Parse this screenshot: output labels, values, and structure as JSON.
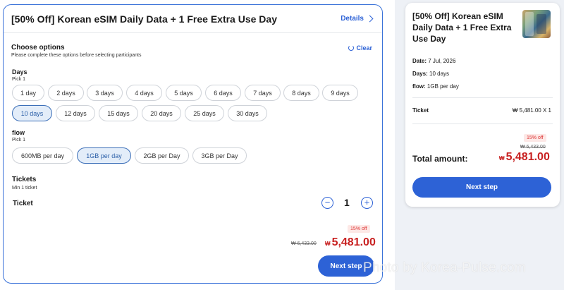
{
  "product": {
    "title": "[50% Off] Korean eSIM Daily Data + 1 Free Extra Use Day",
    "details_label": "Details"
  },
  "options": {
    "title": "Choose options",
    "subtitle": "Please complete these options before selecting participants",
    "clear_label": "Clear"
  },
  "days": {
    "label": "Days",
    "pick": "Pick 1",
    "items": [
      "1 day",
      "2 days",
      "3 days",
      "4 days",
      "5 days",
      "6 days",
      "7 days",
      "8 days",
      "9 days",
      "10 days",
      "12 days",
      "15 days",
      "20 days",
      "25 days",
      "30 days"
    ],
    "selected": "10 days"
  },
  "flow": {
    "label": "flow",
    "pick": "Pick 1",
    "items": [
      "600MB per day",
      "1GB per day",
      "2GB per Day",
      "3GB per Day"
    ],
    "selected": "1GB per day"
  },
  "tickets": {
    "title": "Tickets",
    "subtitle": "Min 1 ticket",
    "row_label": "Ticket",
    "minus": "−",
    "plus": "+",
    "quantity": "1"
  },
  "pricing": {
    "discount_badge": "15% off",
    "original_price": "₩ 6,433.00",
    "currency_symbol": "₩",
    "price": "5,481.00",
    "next_step_label": "Next step"
  },
  "summary": {
    "title": "[50% Off] Korean eSIM Daily Data + 1 Free Extra Use Day",
    "date_label": "Date:",
    "date_value": "7 Jul, 2026",
    "days_label": "Days:",
    "days_value": "10 days",
    "flow_label": "flow:",
    "flow_value": "1GB per day",
    "ticket_label": "Ticket",
    "ticket_value": "₩ 5,481.00 X 1",
    "discount_badge": "15% off",
    "original_price": "₩ 6,433.00",
    "total_label": "Total amount:",
    "currency_symbol": "₩",
    "total_price": "5,481.00",
    "next_step_label": "Next step"
  },
  "watermark": "Photo by Korea-Pulse.com",
  "colors": {
    "accent": "#2d62d6",
    "price_red": "#c82121",
    "selected_chip_bg": "#e3edf9"
  }
}
